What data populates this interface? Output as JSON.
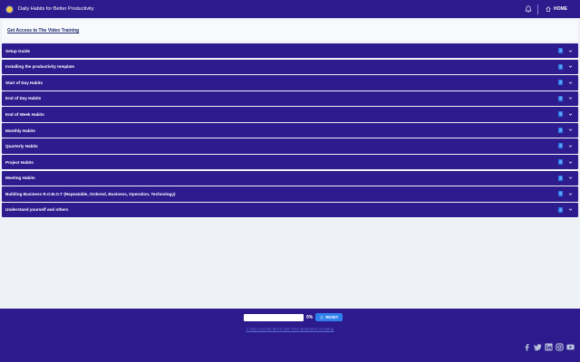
{
  "header": {
    "title": "Daily Habits for Better Productivity",
    "home_label": "HOME"
  },
  "main": {
    "training_link": "Get Access to The Video Training",
    "sections": [
      {
        "label": "Setup Guide",
        "count": "4"
      },
      {
        "label": "Installing the productivity template",
        "count": "2"
      },
      {
        "label": "Start of Day Habits",
        "count": "5"
      },
      {
        "label": "End of Day Habits",
        "count": "5"
      },
      {
        "label": "End of Week Habits",
        "count": "5"
      },
      {
        "label": "Monthly Habits",
        "count": "5"
      },
      {
        "label": "Quarterly Habits",
        "count": "3"
      },
      {
        "label": "Project Habits",
        "count": "6"
      },
      {
        "label": "Meeting Habits",
        "count": "5"
      },
      {
        "label": "Building Business R.O.B.O.T (Repeatable, Ordered, Business, Operation, Technology)",
        "count": "9"
      },
      {
        "label": "Understand yourself and others",
        "count": "4"
      }
    ]
  },
  "footer": {
    "progress_percent": 0,
    "percent_label": "0%",
    "reset_label": "RESET",
    "link_text": "1 Day Access $275 Get Your Business Growing"
  },
  "icons": {
    "logo": "logo-icon",
    "bell": "bell-icon",
    "home": "home-icon",
    "chevron": "chevron-down-icon",
    "reset": "reset-icon",
    "social": [
      "facebook-icon",
      "twitter-icon",
      "linkedin-icon",
      "instagram-icon",
      "youtube-icon"
    ]
  },
  "colors": {
    "brand": "#2d1a8c",
    "accent": "#2f80ed",
    "background": "#eef2f7"
  }
}
